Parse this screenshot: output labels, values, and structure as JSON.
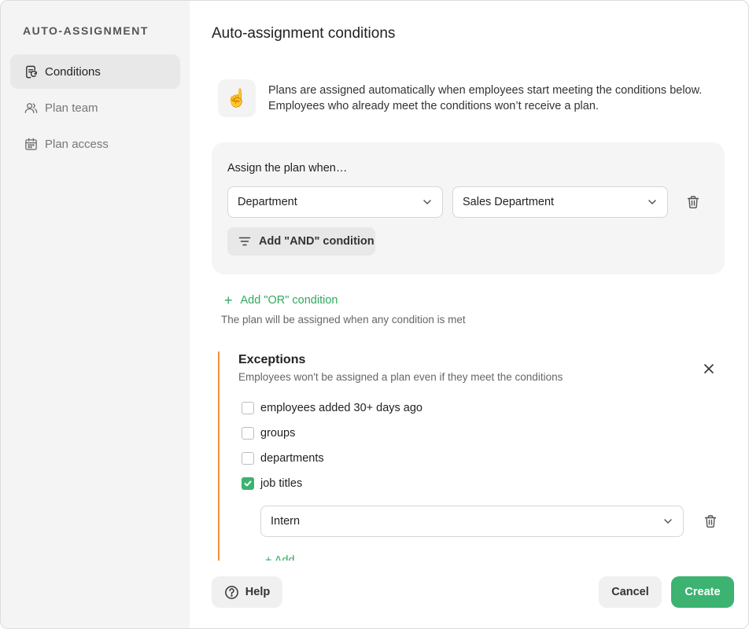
{
  "sidebar": {
    "title": "AUTO-ASSIGNMENT",
    "items": [
      {
        "label": "Conditions",
        "icon": "conditions-icon",
        "active": true
      },
      {
        "label": "Plan team",
        "icon": "users-icon",
        "active": false
      },
      {
        "label": "Plan access",
        "icon": "calendar-icon",
        "active": false
      }
    ]
  },
  "main": {
    "title": "Auto-assignment conditions",
    "hint": {
      "icon": "pointing-hand-icon",
      "emoji": "☝️",
      "text": "Plans are assigned automatically when employees start meeting the conditions below. Employees who already meet the conditions won’t receive a plan."
    },
    "condition": {
      "label": "Assign the plan when…",
      "field": "Department",
      "value": "Sales Department",
      "and_label": "Add \"AND\" condition"
    },
    "or_label": "Add \"OR\" condition",
    "or_note": "The plan will be assigned when any condition is met",
    "exceptions": {
      "title": "Exceptions",
      "subtitle": "Employees won't be assigned a plan even if they meet the conditions",
      "options": [
        {
          "label": "employees added 30+ days ago",
          "checked": false
        },
        {
          "label": "groups",
          "checked": false
        },
        {
          "label": "departments",
          "checked": false
        },
        {
          "label": "job titles",
          "checked": true
        }
      ],
      "job_title_value": "Intern",
      "add_label": "Add"
    }
  },
  "footer": {
    "help_label": "Help",
    "cancel_label": "Cancel",
    "create_label": "Create"
  },
  "colors": {
    "accent": "#3cb371",
    "exceptions_border": "#f0923a",
    "sidebar_bg": "#f4f4f4"
  }
}
